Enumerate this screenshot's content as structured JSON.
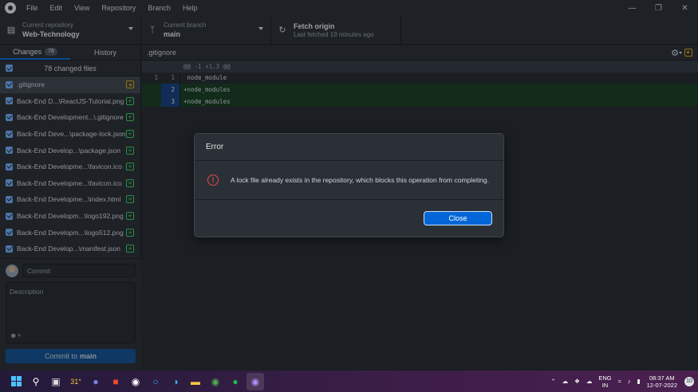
{
  "menu": {
    "items": [
      "File",
      "Edit",
      "View",
      "Repository",
      "Branch",
      "Help"
    ]
  },
  "toolbar": {
    "repo_label": "Current repository",
    "repo_value": "Web-Technology",
    "branch_label": "Current branch",
    "branch_value": "main",
    "fetch_label": "Fetch origin",
    "fetch_sub": "Last fetched 19 minutes ago"
  },
  "sidebar": {
    "tab_changes": "Changes",
    "changes_count": "78",
    "tab_history": "History",
    "files_count_text": "78 changed files",
    "files": [
      {
        "name": ".gitignore",
        "status": "modified"
      },
      {
        "name": "Back-End D...\\ReactJS-Tutorial.png",
        "status": "added"
      },
      {
        "name": "Back-End Development...\\.gitignore",
        "status": "added"
      },
      {
        "name": "Back-End Deve...\\package-lock.json",
        "status": "added"
      },
      {
        "name": "Back-End Develop...\\package.json",
        "status": "added"
      },
      {
        "name": "Back-End Developme...\\favicon.ico",
        "status": "added"
      },
      {
        "name": "Back-End Developme...\\favicon.ico",
        "status": "added"
      },
      {
        "name": "Back-End Developme...\\index.html",
        "status": "added"
      },
      {
        "name": "Back-End Developm...\\logo192.png",
        "status": "added"
      },
      {
        "name": "Back-End Developm...\\logo512.png",
        "status": "added"
      },
      {
        "name": "Back-End Develop...\\manifest.json",
        "status": "added"
      }
    ],
    "commit_placeholder": "Commit",
    "description_placeholder": "Description",
    "commit_button_prefix": "Commit to",
    "commit_button_branch": "main"
  },
  "diff": {
    "path": ".gitignore",
    "hunk": "@@ -1 +1,3 @@",
    "lines": [
      {
        "old": "1",
        "new": "1",
        "text": " node_module",
        "type": "context"
      },
      {
        "old": "",
        "new": "2",
        "text": "+node_modules",
        "type": "add"
      },
      {
        "old": "",
        "new": "3",
        "text": "+node_modules",
        "type": "add"
      }
    ]
  },
  "dialog": {
    "title": "Error",
    "message": "A lock file already exists in the repository, which blocks this operation from completing.",
    "close_label": "Close"
  },
  "taskbar": {
    "weather": "31°",
    "lang_top": "ENG",
    "lang_bottom": "IN",
    "time": "08:37 AM",
    "date": "12-07-2022",
    "notifications": "10"
  },
  "colors": {
    "accent": "#0366d6",
    "added": "#34d058",
    "modified": "#d7a400",
    "error": "#e04a52"
  }
}
